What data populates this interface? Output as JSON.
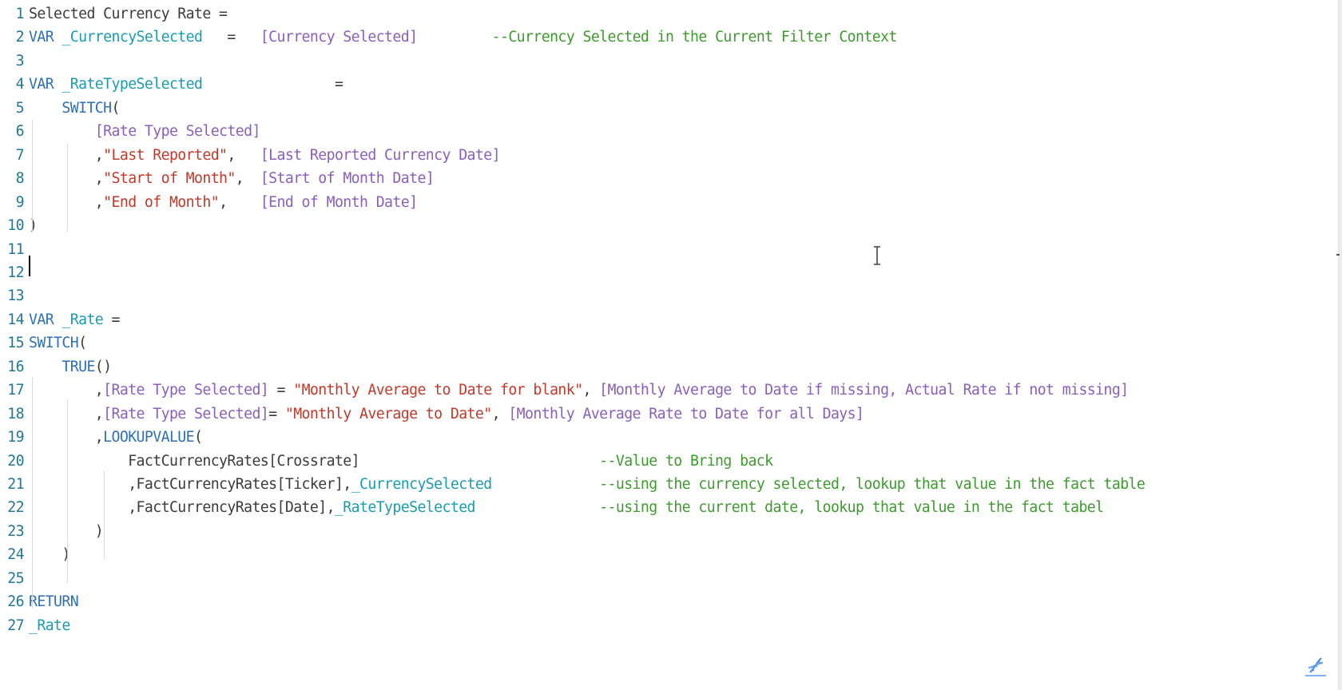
{
  "editor": {
    "lines": [
      {
        "n": "1",
        "tokens": [
          {
            "t": "Selected Currency Rate =",
            "c": "plain"
          }
        ]
      },
      {
        "n": "2",
        "tokens": [
          {
            "t": "VAR ",
            "c": "kw"
          },
          {
            "t": "_CurrencySelected",
            "c": "var"
          },
          {
            "t": "   =   ",
            "c": "op"
          },
          {
            "t": "[Currency Selected]",
            "c": "meas"
          },
          {
            "t": "         ",
            "c": "plain"
          },
          {
            "t": "--Currency Selected in the Current Filter Context",
            "c": "com"
          }
        ]
      },
      {
        "n": "3",
        "tokens": []
      },
      {
        "n": "4",
        "tokens": [
          {
            "t": "VAR ",
            "c": "kw"
          },
          {
            "t": "_RateTypeSelected",
            "c": "var"
          },
          {
            "t": "                =",
            "c": "op"
          }
        ]
      },
      {
        "n": "5",
        "tokens": [
          {
            "t": "    ",
            "c": "plain"
          },
          {
            "t": "SWITCH",
            "c": "kw"
          },
          {
            "t": "(",
            "c": "op"
          }
        ]
      },
      {
        "n": "6",
        "tokens": [
          {
            "t": "        ",
            "c": "plain"
          },
          {
            "t": "[Rate Type Selected]",
            "c": "meas"
          }
        ]
      },
      {
        "n": "7",
        "tokens": [
          {
            "t": "        ,",
            "c": "op"
          },
          {
            "t": "\"Last Reported\"",
            "c": "str"
          },
          {
            "t": ",   ",
            "c": "op"
          },
          {
            "t": "[Last Reported Currency Date]",
            "c": "meas"
          }
        ]
      },
      {
        "n": "8",
        "tokens": [
          {
            "t": "        ,",
            "c": "op"
          },
          {
            "t": "\"Start of Month\"",
            "c": "str"
          },
          {
            "t": ",  ",
            "c": "op"
          },
          {
            "t": "[Start of Month Date]",
            "c": "meas"
          }
        ]
      },
      {
        "n": "9",
        "tokens": [
          {
            "t": "        ,",
            "c": "op"
          },
          {
            "t": "\"End of Month\"",
            "c": "str"
          },
          {
            "t": ",    ",
            "c": "op"
          },
          {
            "t": "[End of Month Date]",
            "c": "meas"
          }
        ]
      },
      {
        "n": "10",
        "tokens": [
          {
            "t": ")",
            "c": "op"
          }
        ]
      },
      {
        "n": "11",
        "tokens": []
      },
      {
        "n": "12",
        "tokens": []
      },
      {
        "n": "13",
        "tokens": []
      },
      {
        "n": "14",
        "tokens": [
          {
            "t": "VAR ",
            "c": "kw"
          },
          {
            "t": "_Rate",
            "c": "var"
          },
          {
            "t": " =",
            "c": "op"
          }
        ]
      },
      {
        "n": "15",
        "tokens": [
          {
            "t": "SWITCH",
            "c": "kw"
          },
          {
            "t": "(",
            "c": "op"
          }
        ]
      },
      {
        "n": "16",
        "tokens": [
          {
            "t": "    ",
            "c": "plain"
          },
          {
            "t": "TRUE",
            "c": "kw"
          },
          {
            "t": "()",
            "c": "op"
          }
        ]
      },
      {
        "n": "17",
        "tokens": [
          {
            "t": "        ,",
            "c": "op"
          },
          {
            "t": "[Rate Type Selected]",
            "c": "meas"
          },
          {
            "t": " = ",
            "c": "op"
          },
          {
            "t": "\"Monthly Average to Date for blank\"",
            "c": "str"
          },
          {
            "t": ", ",
            "c": "op"
          },
          {
            "t": "[Monthly Average to Date if missing, Actual Rate if not missing]",
            "c": "meas"
          }
        ]
      },
      {
        "n": "18",
        "tokens": [
          {
            "t": "        ,",
            "c": "op"
          },
          {
            "t": "[Rate Type Selected]",
            "c": "meas"
          },
          {
            "t": "= ",
            "c": "op"
          },
          {
            "t": "\"Monthly Average to Date\"",
            "c": "str"
          },
          {
            "t": ", ",
            "c": "op"
          },
          {
            "t": "[Monthly Average Rate to Date for all Days]",
            "c": "meas"
          }
        ]
      },
      {
        "n": "19",
        "tokens": [
          {
            "t": "        ,",
            "c": "op"
          },
          {
            "t": "LOOKUPVALUE",
            "c": "kw"
          },
          {
            "t": "(",
            "c": "op"
          }
        ]
      },
      {
        "n": "20",
        "tokens": [
          {
            "t": "            FactCurrencyRates[Crossrate]",
            "c": "plain"
          },
          {
            "t": "                             ",
            "c": "plain"
          },
          {
            "t": "--Value to Bring back",
            "c": "com"
          }
        ]
      },
      {
        "n": "21",
        "tokens": [
          {
            "t": "            ,FactCurrencyRates[Ticker],",
            "c": "plain"
          },
          {
            "t": "_CurrencySelected",
            "c": "var"
          },
          {
            "t": "             ",
            "c": "plain"
          },
          {
            "t": "--using the currency selected, lookup that value in the fact table",
            "c": "com"
          }
        ]
      },
      {
        "n": "22",
        "tokens": [
          {
            "t": "            ,FactCurrencyRates[Date],",
            "c": "plain"
          },
          {
            "t": "_RateTypeSelected",
            "c": "var"
          },
          {
            "t": "               ",
            "c": "plain"
          },
          {
            "t": "--using the current date, lookup that value in the fact tabel",
            "c": "com"
          }
        ]
      },
      {
        "n": "23",
        "tokens": [
          {
            "t": "        )",
            "c": "op"
          }
        ]
      },
      {
        "n": "24",
        "tokens": [
          {
            "t": "    )",
            "c": "op"
          }
        ]
      },
      {
        "n": "25",
        "tokens": []
      },
      {
        "n": "26",
        "tokens": [
          {
            "t": "RETURN",
            "c": "kw"
          }
        ]
      },
      {
        "n": "27",
        "tokens": [
          {
            "t": "_Rate",
            "c": "var"
          }
        ]
      }
    ],
    "cursor_line": "11"
  },
  "icons": {
    "text_cursor": "i-beam-cursor-icon",
    "watermark": "dna-subscribe-icon"
  },
  "colors": {
    "keyword": "#2f6fb3",
    "variable": "#1a9bb0",
    "measure": "#8a5fb8",
    "string": "#c0392b",
    "comment": "#3e9a2f",
    "line_number": "#237893"
  }
}
